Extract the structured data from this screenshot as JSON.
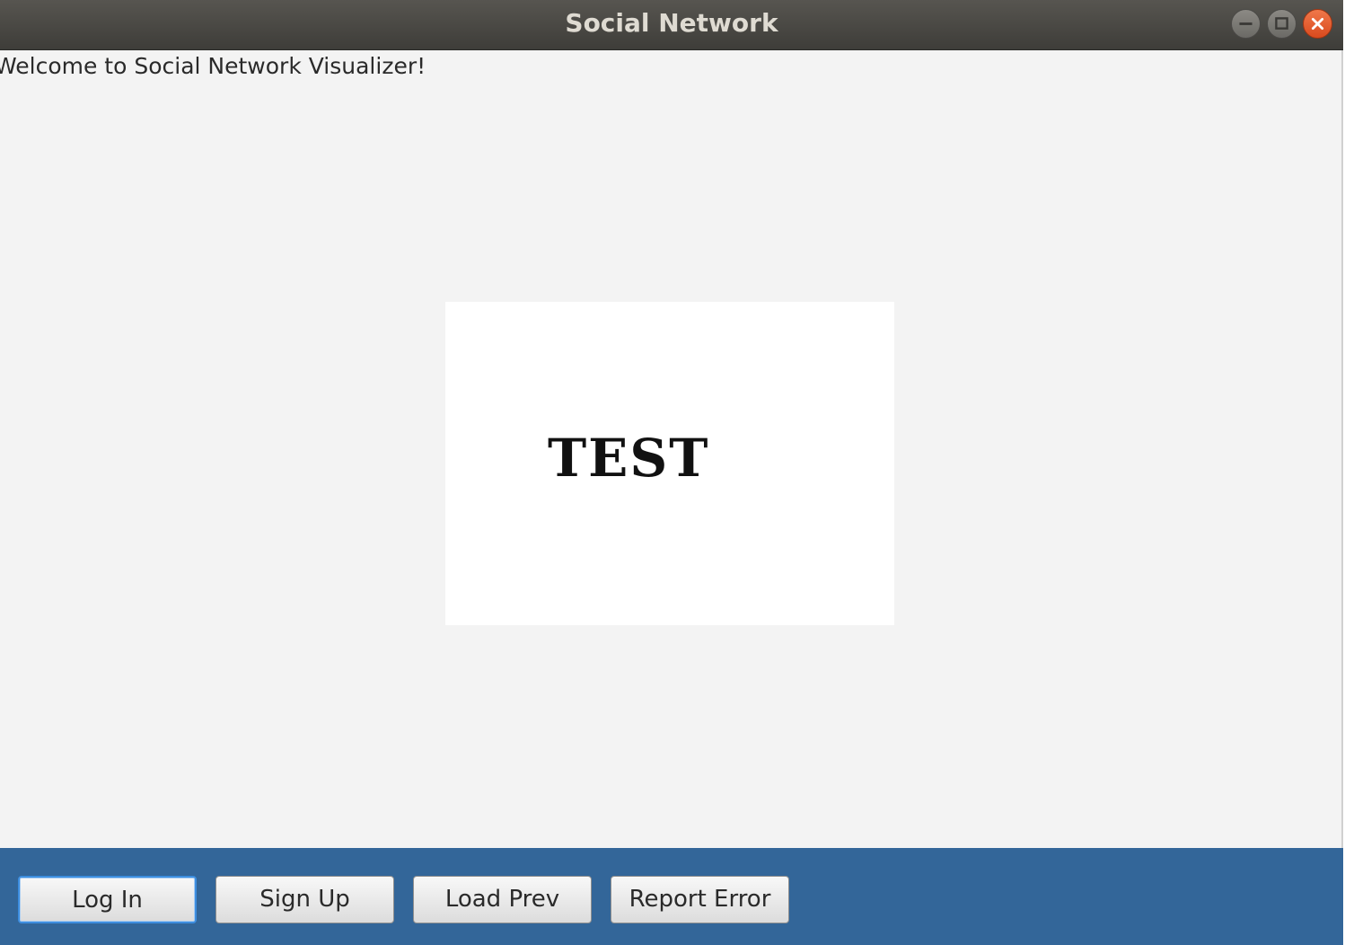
{
  "window": {
    "title": "Social Network"
  },
  "main": {
    "welcome_text": "Welcome to Social Network Visualizer!",
    "image_text": "TEST"
  },
  "buttons": {
    "login": "Log In",
    "signup": "Sign Up",
    "load_prev": "Load Prev",
    "report_error": "Report Error"
  },
  "colors": {
    "bottom_bar": "#336699",
    "close_button": "#e0541f",
    "background": "#f3f3f3"
  },
  "icons": {
    "minimize": "minimize-icon",
    "maximize": "maximize-icon",
    "close": "close-icon"
  }
}
